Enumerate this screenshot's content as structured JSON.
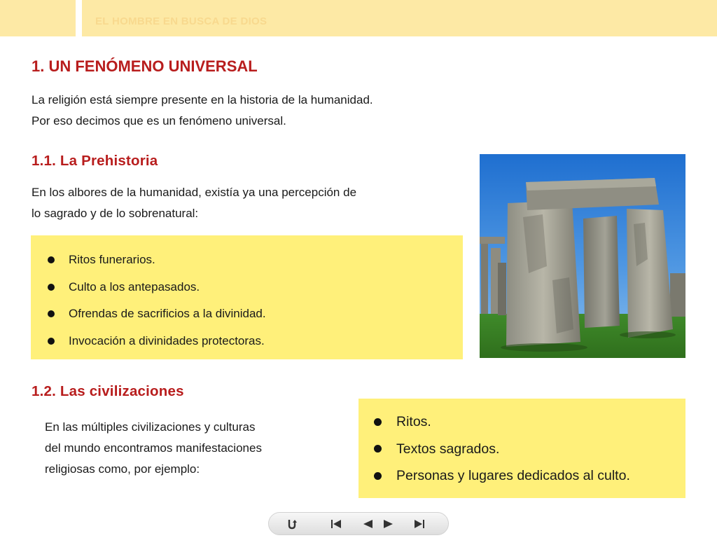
{
  "header": {
    "title": "EL HOMBRE EN BUSCA DE DIOS"
  },
  "section1": {
    "title": "1. UN FENÓMENO UNIVERSAL",
    "intro_lines": [
      "La religión está siempre presente en la historia de la humanidad.",
      "Por eso decimos que es un fenómeno universal."
    ]
  },
  "prehistory": {
    "title": "1.1. La Prehistoria",
    "text_lines": [
      "En los albores de la humanidad, existía ya una percepción de",
      "lo sagrado y de lo sobrenatural:"
    ],
    "bullets": [
      "Ritos funerarios.",
      "Culto a los antepasados.",
      "Ofrendas de sacrificios a la divinidad.",
      "Invocación a divinidades protectoras."
    ]
  },
  "civilizations": {
    "title": "1.2. Las civilizaciones",
    "text_lines": [
      "En las múltiples civilizaciones y culturas",
      "del mundo encontramos manifestaciones",
      "religiosas como, por ejemplo:"
    ],
    "bullets": [
      "Ritos.",
      "Textos sagrados.",
      "Personas y lugares dedicados al culto."
    ]
  },
  "photo": {
    "icon": "stonehenge-photo"
  },
  "nav": {
    "buttons": [
      "back-icon",
      "first-page-icon",
      "previous-page-icon",
      "next-page-icon",
      "last-page-icon"
    ]
  },
  "colors": {
    "accent_red": "#b81d1d",
    "header_yellow": "#fde9a5",
    "box_yellow": "#fff07a"
  }
}
